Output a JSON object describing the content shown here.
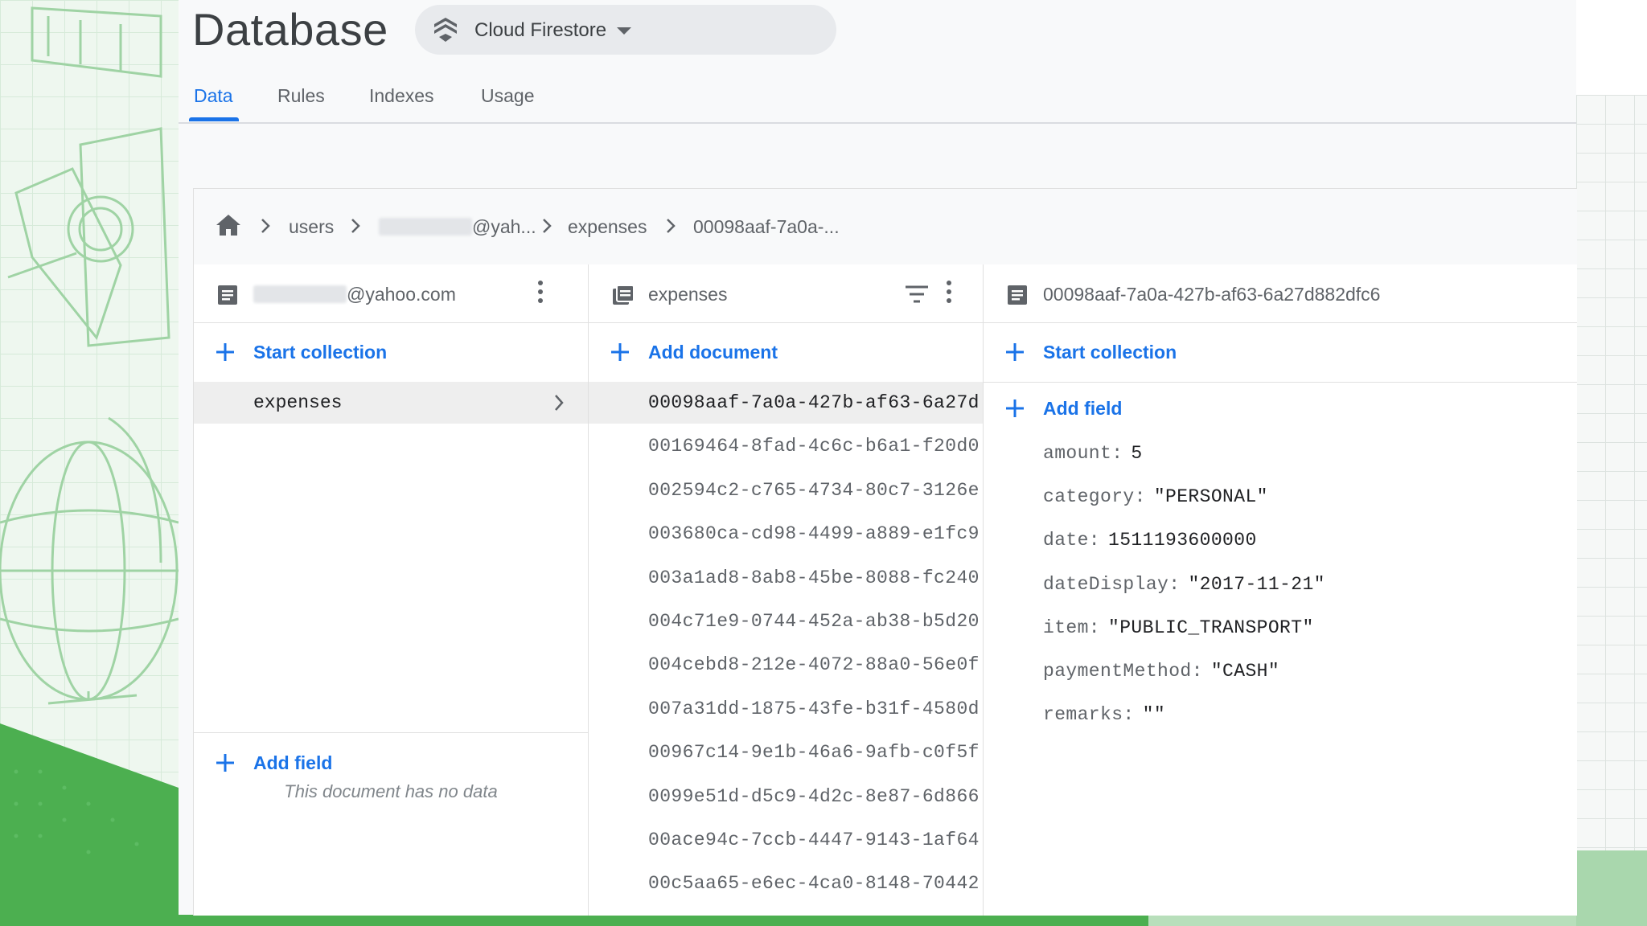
{
  "header": {
    "title": "Database",
    "db_selector": "Cloud Firestore"
  },
  "tabs": [
    {
      "label": "Data",
      "active": true
    },
    {
      "label": "Rules",
      "active": false
    },
    {
      "label": "Indexes",
      "active": false
    },
    {
      "label": "Usage",
      "active": false
    }
  ],
  "breadcrumb": {
    "items": [
      "users",
      "@yah...",
      "expenses",
      "00098aaf-7a0a-..."
    ]
  },
  "user_column": {
    "title_suffix": "@yahoo.com",
    "start_collection": "Start collection",
    "collection_item": "expenses",
    "add_field": "Add field",
    "empty_message": "This document has no data"
  },
  "collection_column": {
    "title": "expenses",
    "add_document": "Add document",
    "documents": [
      "00098aaf-7a0a-427b-af63-6a27d",
      "00169464-8fad-4c6c-b6a1-f20d0",
      "002594c2-c765-4734-80c7-3126e",
      "003680ca-cd98-4499-a889-e1fc9",
      "003a1ad8-8ab8-45be-8088-fc240",
      "004c71e9-0744-452a-ab38-b5d20",
      "004cebd8-212e-4072-88a0-56e0f",
      "007a31dd-1875-43fe-b31f-4580d",
      "00967c14-9e1b-46a6-9afb-c0f5f",
      "0099e51d-d5c9-4d2c-8e87-6d866",
      "00ace94c-7ccb-4447-9143-1af64",
      "00c5aa65-e6ec-4ca0-8148-70442"
    ],
    "selected_index": 0
  },
  "document_column": {
    "title": "00098aaf-7a0a-427b-af63-6a27d882dfc6",
    "start_collection": "Start collection",
    "add_field": "Add field",
    "fields": [
      {
        "key": "amount:",
        "value": "5"
      },
      {
        "key": "category:",
        "value": "\"PERSONAL\""
      },
      {
        "key": "date:",
        "value": "1511193600000"
      },
      {
        "key": "dateDisplay:",
        "value": "\"2017-11-21\""
      },
      {
        "key": "item:",
        "value": "\"PUBLIC_TRANSPORT\""
      },
      {
        "key": "paymentMethod:",
        "value": "\"CASH\""
      },
      {
        "key": "remarks:",
        "value": "\"\""
      }
    ]
  },
  "colors": {
    "accent": "#1a73e8",
    "text_primary": "#202124",
    "text_secondary": "#5f6368",
    "selected_row": "#eeeeee",
    "background_green": "#4caf50"
  },
  "icons": [
    "firestore-logo-icon",
    "dropdown-caret-icon",
    "home-icon",
    "chevron-right-icon",
    "document-icon",
    "collection-icon",
    "filter-icon",
    "more-vert-icon",
    "plus-icon"
  ]
}
